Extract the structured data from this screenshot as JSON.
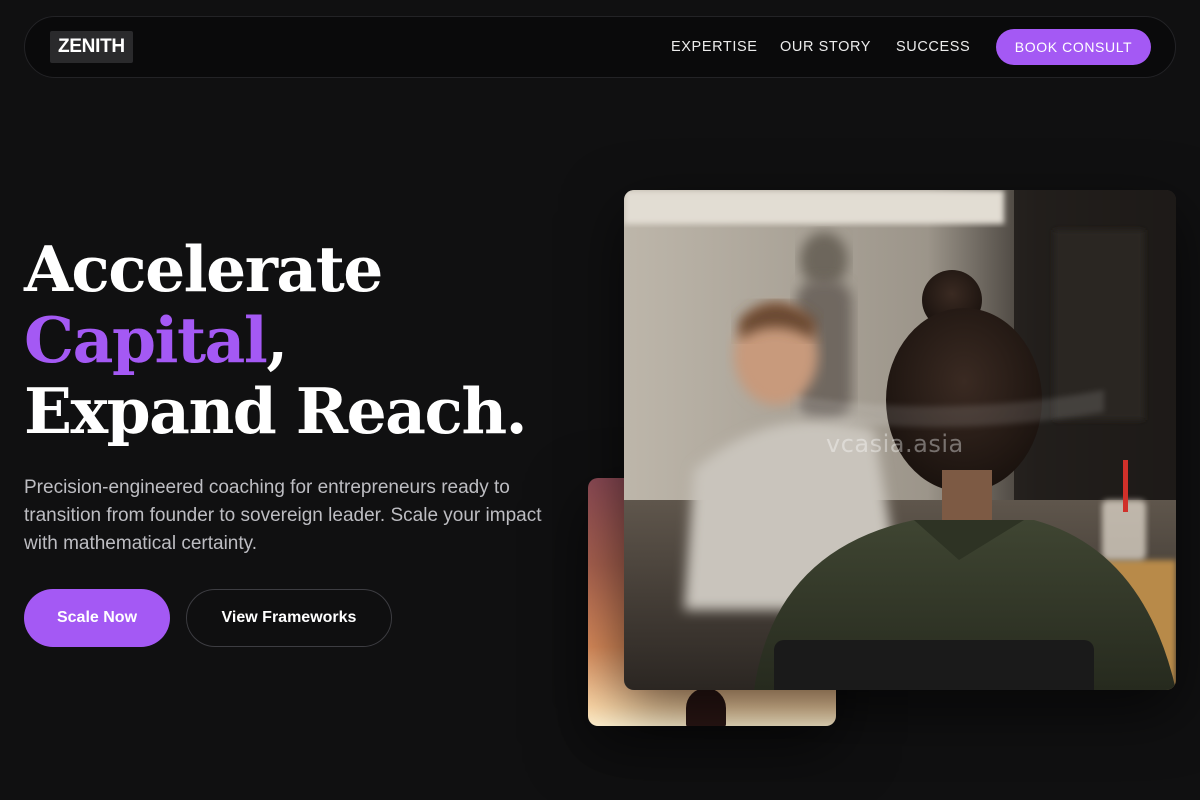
{
  "nav": {
    "logo": "ZENITH",
    "links": [
      "EXPERTISE",
      "OUR STORY",
      "SUCCESS"
    ],
    "cta": "BOOK CONSULT"
  },
  "hero": {
    "title_line1": "Accelerate",
    "title_line2_accent": "Capital",
    "title_line2_rest": ",",
    "title_line3": "Expand Reach.",
    "description": "Precision-engineered coaching for entrepreneurs ready to transition from founder to sovereign leader. Scale your impact with mathematical certainty.",
    "primary_button": "Scale Now",
    "secondary_button": "View Frameworks"
  },
  "imagery": {
    "main_photo_watermark": "vcasia.asia"
  },
  "colors": {
    "accent": "#a459f4",
    "background": "#101011",
    "text_muted": "#bdbdc2"
  }
}
